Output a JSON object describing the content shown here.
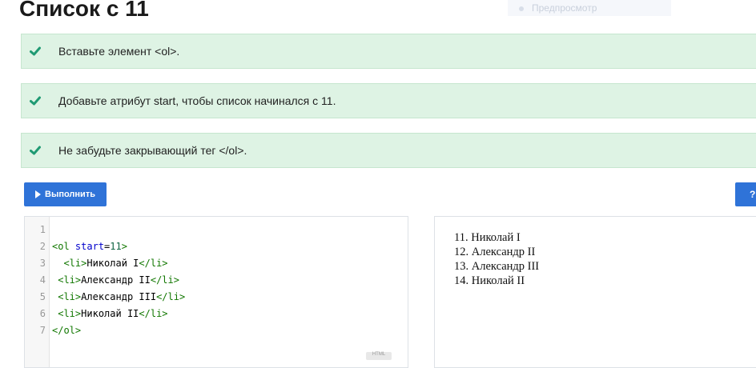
{
  "page": {
    "title": "Список с 11"
  },
  "top_tab": {
    "label": "Предпросмотр"
  },
  "tasks": [
    {
      "text": "Вставьте элемент <ol>.",
      "done": true
    },
    {
      "text": "Добавьте атрибут start, чтобы список начинался с 11.",
      "done": true
    },
    {
      "text": "Не забудьте закрывающий тег </ol>.",
      "done": true
    }
  ],
  "toolbar": {
    "run_label": "Выполнить",
    "help_label": "?"
  },
  "editor": {
    "line_numbers": [
      "1",
      "2",
      "3",
      "4",
      "5",
      "6",
      "7"
    ],
    "lines": [
      [],
      [
        {
          "t": "tag",
          "v": "<ol"
        },
        {
          "t": "txt",
          "v": " "
        },
        {
          "t": "attr",
          "v": "start"
        },
        {
          "t": "txt",
          "v": "="
        },
        {
          "t": "num",
          "v": "11"
        },
        {
          "t": "tag",
          "v": ">"
        }
      ],
      [
        {
          "t": "txt",
          "v": "  "
        },
        {
          "t": "tag",
          "v": "<li>"
        },
        {
          "t": "txt",
          "v": "Николай I"
        },
        {
          "t": "tag",
          "v": "</li>"
        }
      ],
      [
        {
          "t": "txt",
          "v": " "
        },
        {
          "t": "tag",
          "v": "<li>"
        },
        {
          "t": "txt",
          "v": "Александр II"
        },
        {
          "t": "tag",
          "v": "</li>"
        }
      ],
      [
        {
          "t": "txt",
          "v": " "
        },
        {
          "t": "tag",
          "v": "<li>"
        },
        {
          "t": "txt",
          "v": "Александр III"
        },
        {
          "t": "tag",
          "v": "</li>"
        }
      ],
      [
        {
          "t": "txt",
          "v": " "
        },
        {
          "t": "tag",
          "v": "<li>"
        },
        {
          "t": "txt",
          "v": "Николай II"
        },
        {
          "t": "tag",
          "v": "</li>"
        }
      ],
      [
        {
          "t": "tag",
          "v": "</ol>"
        }
      ]
    ],
    "badge": "HTML"
  },
  "preview": {
    "start": 11,
    "items": [
      "Николай I",
      "Александр II",
      "Александр III",
      "Николай II"
    ]
  },
  "colors": {
    "accent": "#2f73d8",
    "success_bg": "#def3e4",
    "check": "#1f9a73"
  },
  "icons": {
    "task_done": "check-icon",
    "run": "play-icon"
  }
}
